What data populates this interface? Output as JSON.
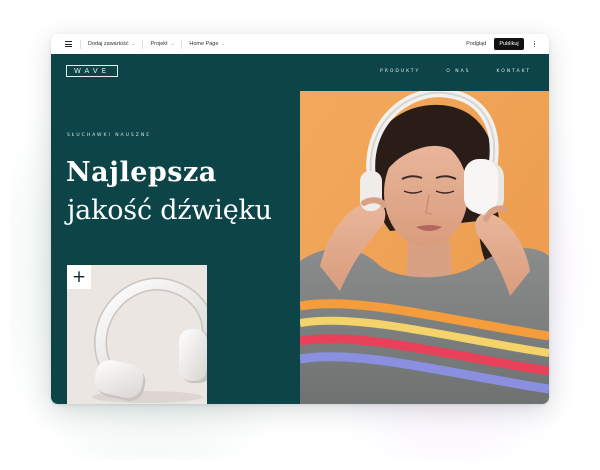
{
  "editor_bar": {
    "add_content": "Dodaj zawartość",
    "project": "Projekt",
    "page": "Home Page",
    "preview": "Podgląd",
    "publish": "Publikuj"
  },
  "site": {
    "logo": "WAVE",
    "nav": [
      "PRODUKTY",
      "O NAS",
      "KONTAKT"
    ],
    "eyebrow": "SŁUCHAWKI NAUSZNE",
    "headline_bold": "Najlepsza",
    "headline_light": "jakość dźwięku",
    "plus": "+"
  },
  "colors": {
    "primary": "#0c4447",
    "hero_bg": "#f1a357",
    "card_bg": "#ece6e3",
    "publish_button": "#111111"
  }
}
